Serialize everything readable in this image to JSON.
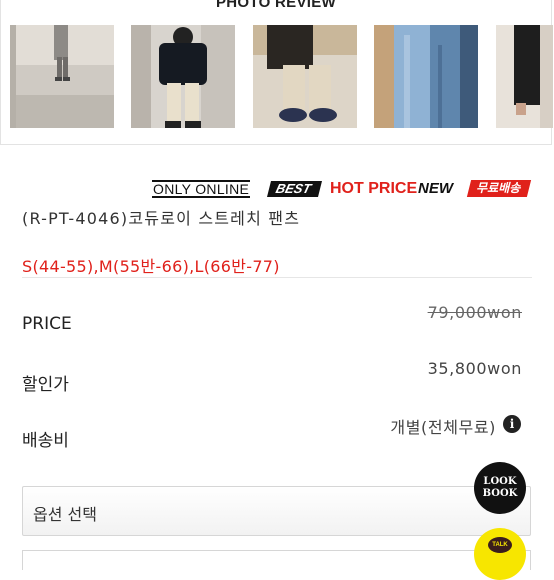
{
  "review": {
    "title": "PHOTO REVIEW",
    "photos": [
      {
        "icon": "photo-gray-pants-mirror"
      },
      {
        "icon": "photo-black-jacket-beige-pants"
      },
      {
        "icon": "photo-beige-pants-navy-shoes"
      },
      {
        "icon": "photo-blue-denim-pants"
      },
      {
        "icon": "photo-dark-pants-partial"
      }
    ]
  },
  "badges": {
    "only_online": "ONLY ONLINE",
    "best": "BEST",
    "hot_price": "HOT PRICE",
    "new": "NEW",
    "free_shipping": "무료배송"
  },
  "product": {
    "name": "(R-PT-4046)코듀로이 스트레치 팬츠",
    "sizes": "S(44-55),M(55반-66),L(66반-77)"
  },
  "price": {
    "label": "PRICE",
    "original": "79,000won",
    "discount_label": "할인가",
    "discount_value": "35,800won",
    "shipping_label": "배송비",
    "shipping_value": "개별(전체무료)",
    "info_icon": "i"
  },
  "option": {
    "label": "옵션 선택"
  },
  "floating": {
    "lookbook_line1": "LOOK",
    "lookbook_line2": "BOOK",
    "talk": "TALK"
  },
  "colors": {
    "accent_red": "#e0211b",
    "kakao_yellow": "#f7e600"
  }
}
